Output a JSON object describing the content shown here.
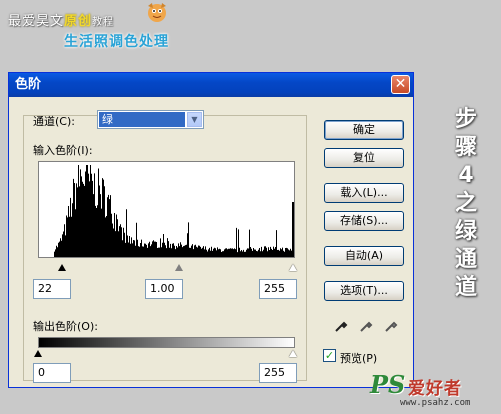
{
  "banner": {
    "line1_a": "最爱昊文",
    "line1_hl": "原创",
    "line1_b": "教程",
    "line2": "生活照调色处理"
  },
  "step_text": "步\n骤\n4\n之\n绿\n通\n道",
  "watermark": {
    "ps": "PS",
    "name": "爱好者",
    "url": "www.psahz.com"
  },
  "dialog": {
    "title": "色阶",
    "close_symbol": "✕",
    "channel_label": "通道",
    "channel_shortcut": "(C):",
    "channel_value": "绿",
    "input_levels_label": "输入色阶",
    "input_levels_shortcut": "(I):",
    "input_values": [
      "22",
      "1.00",
      "255"
    ],
    "output_levels_label": "输出色阶",
    "output_levels_shortcut": "(O):",
    "output_values": [
      "0",
      "255"
    ],
    "buttons": {
      "ok": "确定",
      "reset": "复位",
      "load": "载入(L)...",
      "save": "存储(S)...",
      "auto": "自动(A)",
      "options": "选项(T)..."
    },
    "preview_label": "预览(P)",
    "preview_checked": true
  },
  "colors": {
    "titlebar": "#0447c6",
    "dialog_bg": "#ece9d8",
    "selected": "#316ac5",
    "banner_blue": "#2aa3d6",
    "banner_gold": "#f2d82a"
  }
}
